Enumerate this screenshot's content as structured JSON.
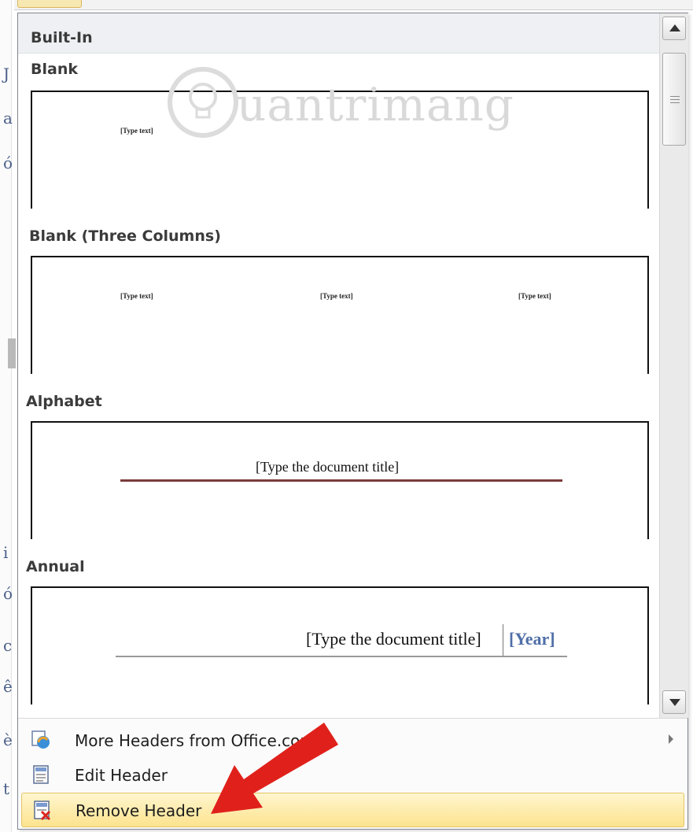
{
  "gallery": {
    "section_title": "Built-In",
    "items": [
      {
        "label": "Blank",
        "placeholders": [
          "[Type text]"
        ]
      },
      {
        "label": "Blank (Three Columns)",
        "placeholders": [
          "[Type text]",
          "[Type text]",
          "[Type text]"
        ]
      },
      {
        "label": "Alphabet",
        "title": "[Type the document title]"
      },
      {
        "label": "Annual",
        "title": "[Type the document title]",
        "year": "[Year]"
      }
    ]
  },
  "menu": {
    "items": [
      {
        "label": "More Headers from Office.com",
        "icon": "office-online-icon",
        "has_submenu": true
      },
      {
        "label": "Edit Header",
        "icon": "edit-header-icon",
        "has_submenu": false
      },
      {
        "label": "Remove Header",
        "icon": "remove-header-icon",
        "has_submenu": false,
        "highlighted": true
      }
    ]
  },
  "colors": {
    "highlight": "#fde38e",
    "annotation_arrow": "#e0211b",
    "alphabet_rule": "#7a3b3b",
    "year_text": "#4f6fa8"
  }
}
